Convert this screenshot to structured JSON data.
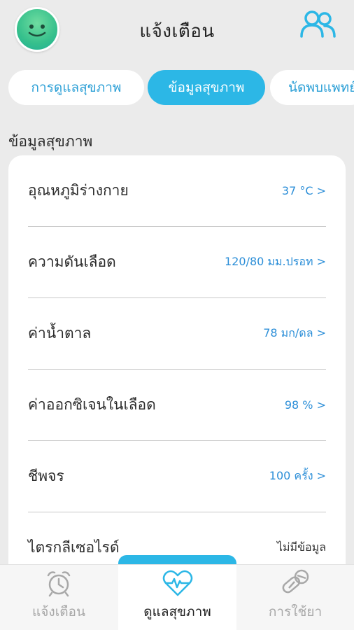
{
  "header": {
    "title": "แจ้งเตือน",
    "avatar_icon": "smiley-avatar-icon",
    "users_icon": "users-icon",
    "accent": "#2cb7e6"
  },
  "tabs": [
    {
      "label": "การดูแลสุขภาพ",
      "active": false
    },
    {
      "label": "ข้อมูลสุขภาพ",
      "active": true
    },
    {
      "label": "นัดพบแพทย์",
      "active": false
    }
  ],
  "section": {
    "title": "ข้อมูลสุขภาพ"
  },
  "health_items": [
    {
      "label": "อุณหภูมิร่างกาย",
      "value": "37 °C >"
    },
    {
      "label": "ความดันเลือด",
      "value": "120/80 มม.ปรอท >"
    },
    {
      "label": "ค่าน้ำตาล",
      "value": "78 มก/ดล >"
    },
    {
      "label": "ค่าออกซิเจนในเลือด",
      "value": "98 % >"
    },
    {
      "label": "ชีพจร",
      "value": "100 ครั้ง >"
    },
    {
      "label": "ไตรกลีเซอไรด์",
      "value": "ไม่มีข้อมูล"
    }
  ],
  "bottom_nav": [
    {
      "label": "แจ้งเตือน",
      "icon": "alarm-clock-icon",
      "active": false
    },
    {
      "label": "ดูแลสุขภาพ",
      "icon": "heartbeat-icon",
      "active": true
    },
    {
      "label": "การใช้ยา",
      "icon": "pills-icon",
      "active": false
    }
  ]
}
